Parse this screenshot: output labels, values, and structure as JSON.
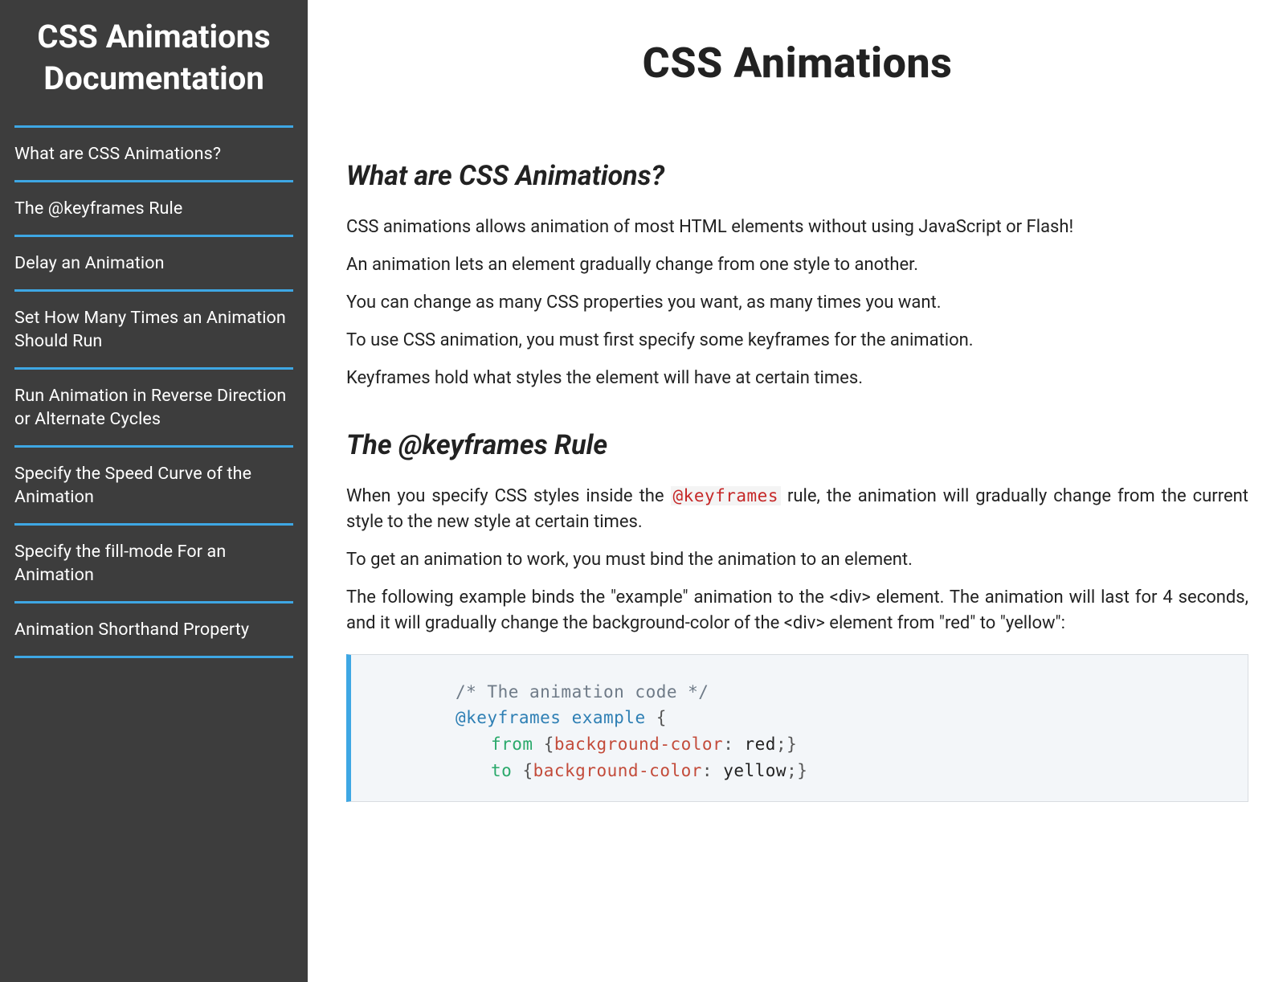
{
  "sidebar": {
    "title": "CSS Animations Documentation",
    "items": [
      {
        "label": "What are CSS Animations?"
      },
      {
        "label": "The @keyframes Rule"
      },
      {
        "label": "Delay an Animation"
      },
      {
        "label": "Set How Many Times an Animation Should Run"
      },
      {
        "label": "Run Animation in Reverse Direction or Alternate Cycles"
      },
      {
        "label": "Specify the Speed Curve of the Animation"
      },
      {
        "label": "Specify the fill-mode For an Animation"
      },
      {
        "label": "Animation Shorthand Property"
      }
    ]
  },
  "page": {
    "title": "CSS Animations"
  },
  "section1": {
    "heading": "What are CSS Animations?",
    "p1": "CSS animations allows animation of most HTML elements without using JavaScript or Flash!",
    "p2": "An animation lets an element gradually change from one style to another.",
    "p3": "You can change as many CSS properties you want, as many times you want.",
    "p4": "To use CSS animation, you must first specify some keyframes for the animation.",
    "p5": "Keyframes hold what styles the element will have at certain times."
  },
  "section2": {
    "heading": "The @keyframes Rule",
    "p1a": "When you specify CSS styles inside the ",
    "p1_code": "@keyframes",
    "p1b": " rule, the animation will gradually change from the current style to the new style at certain times.",
    "p2": "To get an animation to work, you must bind the animation to an element.",
    "p3": "The following example binds the \"example\" animation to the <div> element. The animation will last for 4 seconds, and it will gradually change the background-color of the <div> element from \"red\" to \"yellow\":",
    "code": {
      "comment": "/* The animation code */",
      "rule": "@keyframes",
      "ident": "example",
      "from_keyword": "from",
      "to_keyword": "to",
      "prop": "background-color",
      "from_value": "red",
      "to_value": "yellow"
    }
  }
}
